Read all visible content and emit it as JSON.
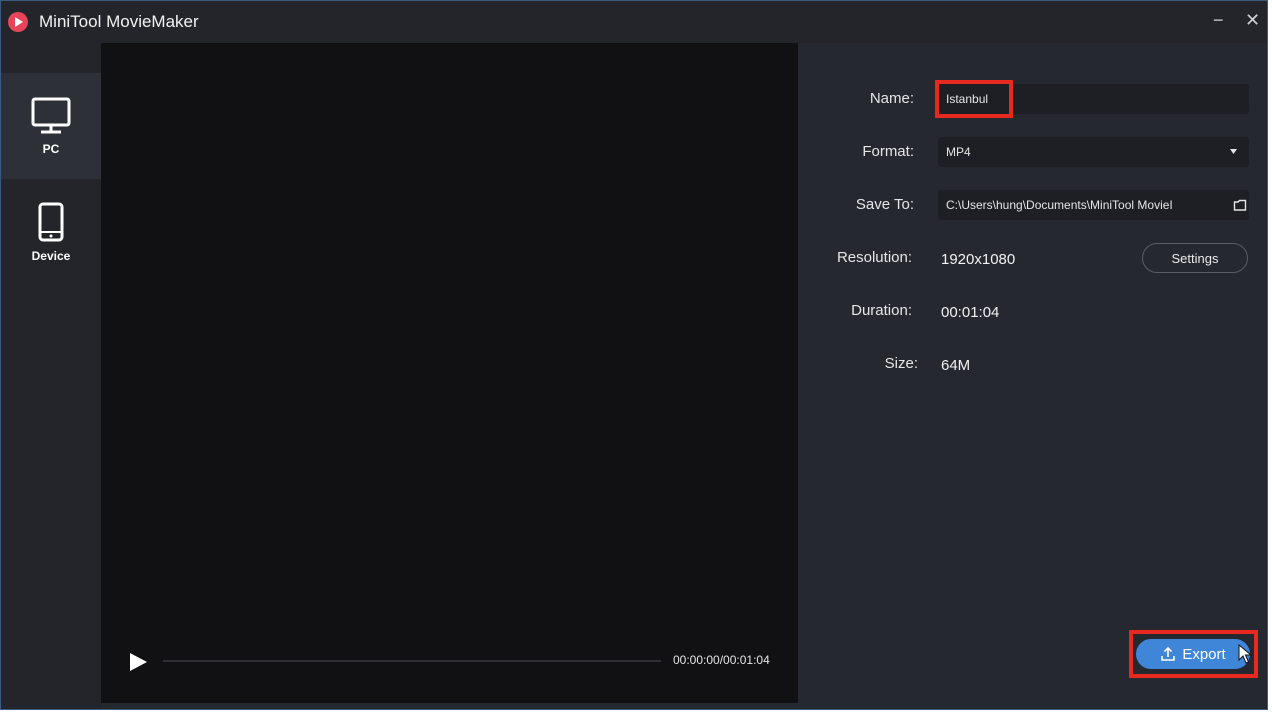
{
  "app": {
    "title": "MiniTool MovieMaker"
  },
  "window_controls": {
    "minimize": "−",
    "close": "✕"
  },
  "sidebar": {
    "items": [
      {
        "label": "PC",
        "icon": "monitor-icon",
        "active": true
      },
      {
        "label": "Device",
        "icon": "phone-icon",
        "active": false
      }
    ]
  },
  "player": {
    "timecode": "00:00:00/00:01:04",
    "progress": 0
  },
  "export_settings": {
    "name_label": "Name:",
    "name_value": "Istanbul",
    "format_label": "Format:",
    "format_value": "MP4",
    "save_label": "Save To:",
    "save_value": "C:\\Users\\hung\\Documents\\MiniTool MovieI",
    "resolution_label": "Resolution:",
    "resolution_value": "1920x1080",
    "settings_button": "Settings",
    "duration_label": "Duration:",
    "duration_value": "00:01:04",
    "size_label": "Size:",
    "size_value": "64M",
    "export_button": "Export"
  },
  "colors": {
    "accent": "#3f86d8",
    "highlight": "#e8291f",
    "brand": "#e8455a"
  }
}
